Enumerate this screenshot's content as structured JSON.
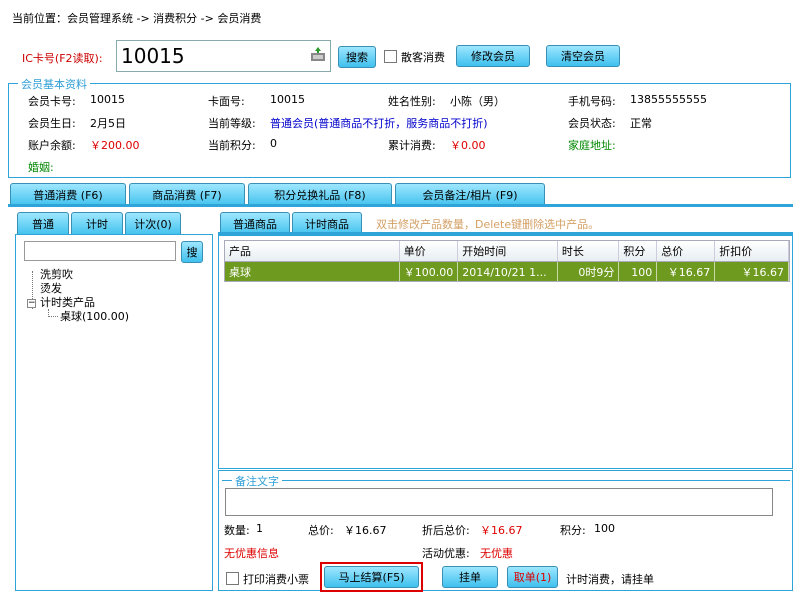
{
  "breadcrumb": "当前位置：会员管理系统 -> 消费积分 -> 会员消费",
  "card": {
    "label": "IC卡号(F2读取):",
    "value": "10015",
    "icon": "card-reader-icon"
  },
  "toolbar": {
    "search": "搜索",
    "walkin_label": "散客消费",
    "edit_member": "修改会员",
    "clear_member": "清空会员"
  },
  "member_info": {
    "legend": "会员基本资料",
    "card_no_label": "会员卡号:",
    "card_no": "10015",
    "face_no_label": "卡面号:",
    "face_no": "10015",
    "name_label": "姓名性别:",
    "name": "小陈（男）",
    "phone_label": "手机号码:",
    "phone": "13855555555",
    "birthday_label": "会员生日:",
    "birthday": "2月5日",
    "level_label": "当前等级:",
    "level": "普通会员(普通商品不打折，服务商品不打折)",
    "status_label": "会员状态:",
    "status": "正常",
    "balance_label": "账户余额:",
    "balance": "￥200.00",
    "points_label": "当前积分:",
    "points": "0",
    "total_label": "累计消费:",
    "total": "￥0.00",
    "address_label": "家庭地址:",
    "marriage_label": "婚姻:"
  },
  "main_tabs": [
    "普通消费 (F6)",
    "商品消费 (F7)",
    "积分兑换礼品 (F8)",
    "会员备注/相片 (F9)"
  ],
  "left_tabs": [
    "普通",
    "计时",
    "计次(0)"
  ],
  "left_search_button": "搜",
  "tree": {
    "items": [
      "洗剪吹",
      "烫发",
      "计时类产品"
    ],
    "child": "桌球(100.00)"
  },
  "right_tabs": [
    "普通商品",
    "计时商品"
  ],
  "hint": "双击修改产品数量，Delete键删除选中产品。",
  "table": {
    "headers": [
      "产品",
      "单价",
      "开始时间",
      "时长",
      "积分",
      "总价",
      "折扣价"
    ],
    "rows": [
      [
        "桌球",
        "￥100.00",
        "2014/10/21 1...",
        "0时9分",
        "100",
        "￥16.67",
        "￥16.67"
      ]
    ]
  },
  "remarks": {
    "legend": "备注文字",
    "qty_label": "数量:",
    "qty": "1",
    "total_label": "总价:",
    "total": "￥16.67",
    "discounted_label": "折后总价:",
    "discounted": "￥16.67",
    "points_label": "积分:",
    "points": "100",
    "no_discount": "无优惠信息",
    "activity_label": "活动优惠:",
    "activity": "无优惠"
  },
  "bottom": {
    "print_label": "打印消费小票",
    "settle": "马上结算(F5)",
    "hold": "挂单",
    "retrieve": "取单(1)",
    "hint": "计时消费，请挂单"
  },
  "colors": {
    "accent": "#2fa4d9",
    "button_top": "#9ee7ff",
    "button_bottom": "#3fc0ee",
    "selected_row": "#6e9a1f",
    "highlight_box": "#dd0000"
  }
}
